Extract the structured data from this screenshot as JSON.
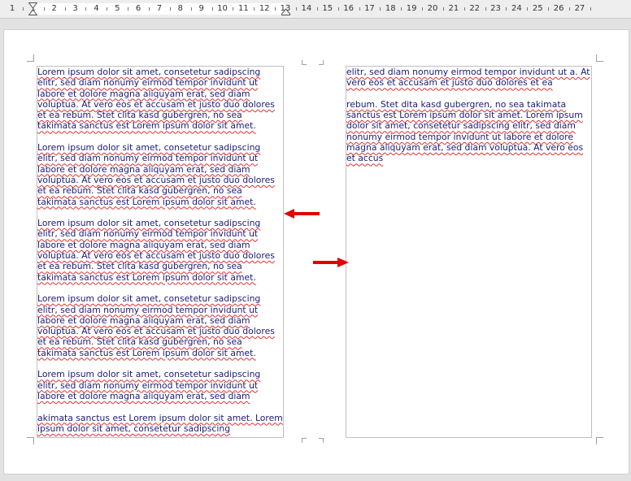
{
  "ruler": {
    "numbers": [
      "1",
      "1",
      "2",
      "3",
      "4",
      "5",
      "6",
      "7",
      "8",
      "9",
      "10",
      "11",
      "12",
      "13",
      "14",
      "15",
      "16",
      "17",
      "18",
      "19",
      "20",
      "21",
      "22",
      "23",
      "24",
      "25",
      "26",
      "27"
    ]
  },
  "left_column": {
    "paragraphs": [
      "Lorem ipsum dolor sit amet, consetetur sadipscing elitr, sed diam nonumy eirmod tempor invidunt ut labore et dolore magna aliquyam erat, sed diam voluptua. At vero eos et accusam et justo duo dolores et ea rebum. Stet clita kasd gubergren, no sea takimata sanctus est Lorem ipsum dolor sit amet.",
      "Lorem ipsum dolor sit amet, consetetur sadipscing elitr, sed diam nonumy eirmod tempor invidunt ut labore et dolore magna aliquyam erat, sed diam voluptua. At vero eos et accusam et justo duo dolores et ea rebum. Stet clita kasd gubergren, no sea takimata sanctus est Lorem ipsum dolor sit amet.",
      "Lorem ipsum dolor sit amet, consetetur sadipscing elitr, sed diam nonumy eirmod tempor invidunt ut labore et dolore magna aliquyam erat, sed diam voluptua. At vero eos et accusam et justo duo dolores et ea rebum. Stet clita kasd gubergren, no sea takimata sanctus est Lorem ipsum dolor sit amet.",
      "Lorem ipsum dolor sit amet, consetetur sadipscing elitr, sed diam nonumy eirmod tempor invidunt ut labore et dolore magna aliquyam erat, sed diam voluptua. At vero eos et accusam et justo duo dolores et ea rebum. Stet clita kasd gubergren, no sea takimata sanctus est Lorem ipsum dolor sit amet.",
      "Lorem ipsum dolor sit amet, consetetur sadipscing elitr, sed diam nonumy eirmod tempor invidunt ut labore et dolore magna aliquyam erat, sed diam",
      "akimata sanctus est Lorem ipsum dolor sit amet. Lorem ipsum dolor sit amet, consetetur sadipscing"
    ]
  },
  "right_column": {
    "paragraphs": [
      "elitr, sed diam nonumy eirmod tempor invidunt ut a. At vero eos et accusam et justo duo dolores et ea",
      "rebum. Stet dita kasd gubergren, no sea takimata sanctus est Lorem ipsum dolor sit amet. Lorem ipsum dolor sit amet, consetetur sadipscing elitr, sed diam nonumy eirmod tempor invidunt ut labore et dolore magna aliquyam erat, sed diam voluptua. At vero eos et accus"
    ]
  },
  "colors": {
    "arrow": "#e00000",
    "spellcheck": "#e03030"
  }
}
